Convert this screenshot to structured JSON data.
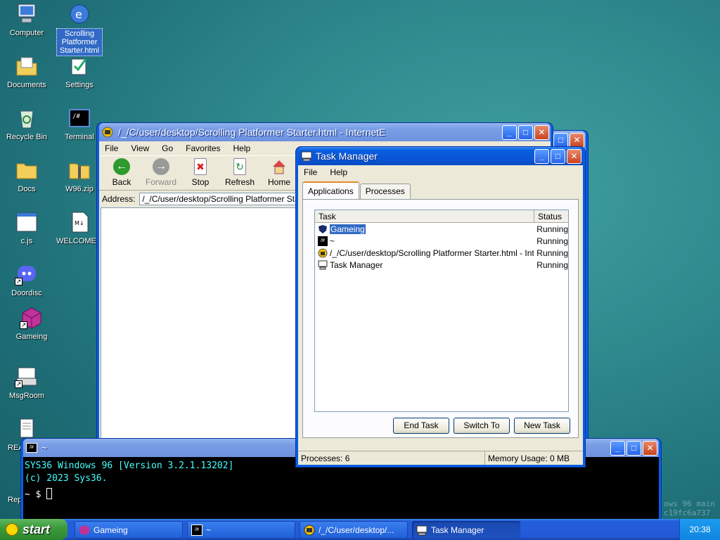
{
  "desktop": {
    "icons": [
      {
        "label": "Computer"
      },
      {
        "label": "Scrolling Platformer Starter.html"
      },
      {
        "label": "Documents"
      },
      {
        "label": "Settings"
      },
      {
        "label": "Recycle Bin"
      },
      {
        "label": "Terminal"
      },
      {
        "label": "Docs"
      },
      {
        "label": "W96.zip"
      },
      {
        "label": "c.js"
      },
      {
        "label": "WELCOME..."
      },
      {
        "label": "Doordisc"
      },
      {
        "label": "Gameing"
      },
      {
        "label": "MsgRoom"
      },
      {
        "label": "READ"
      },
      {
        "label": "Rep"
      }
    ],
    "watermark_line1": "ows 96 main",
    "watermark_line2": "c19fc6a737"
  },
  "ie": {
    "title": "/_/C/user/desktop/Scrolling Platformer Starter.html - InternetE",
    "menu": [
      "File",
      "View",
      "Go",
      "Favorites",
      "Help"
    ],
    "toolbar": [
      "Back",
      "Forward",
      "Stop",
      "Refresh",
      "Home"
    ],
    "address_label": "Address:",
    "address_value": "/_/C/user/desktop/Scrolling Platformer Starter.html"
  },
  "taskmgr": {
    "title": "Task Manager",
    "menu": [
      "File",
      "Help"
    ],
    "tabs": [
      "Applications",
      "Processes"
    ],
    "columns": [
      "Task",
      "Status"
    ],
    "rows": [
      {
        "task": "Gameing",
        "status": "Running"
      },
      {
        "task": "~",
        "status": "Running"
      },
      {
        "task": "/_/C/user/desktop/Scrolling Platformer Starter.html - InternetE",
        "status": "Running"
      },
      {
        "task": "Task Manager",
        "status": "Running"
      }
    ],
    "buttons": [
      "End Task",
      "Switch To",
      "New Task"
    ],
    "status_processes": "Processes: 6",
    "status_memory": "Memory Usage: 0 MB"
  },
  "terminal": {
    "title": "~",
    "line1": "SYS36 Windows 96 [Version 3.2.1.13202]",
    "line2": "(c) 2023 Sys36.",
    "prompt": "~ $"
  },
  "taskbar": {
    "start_label": "start",
    "items": [
      "Gameing",
      "~",
      "/_/C/user/desktop/...",
      "Task Manager"
    ],
    "clock": "20:38"
  },
  "colors": {
    "titlebar": "#0a5ee0",
    "selection": "#316ac5",
    "terminal_text": "#44ffff"
  }
}
